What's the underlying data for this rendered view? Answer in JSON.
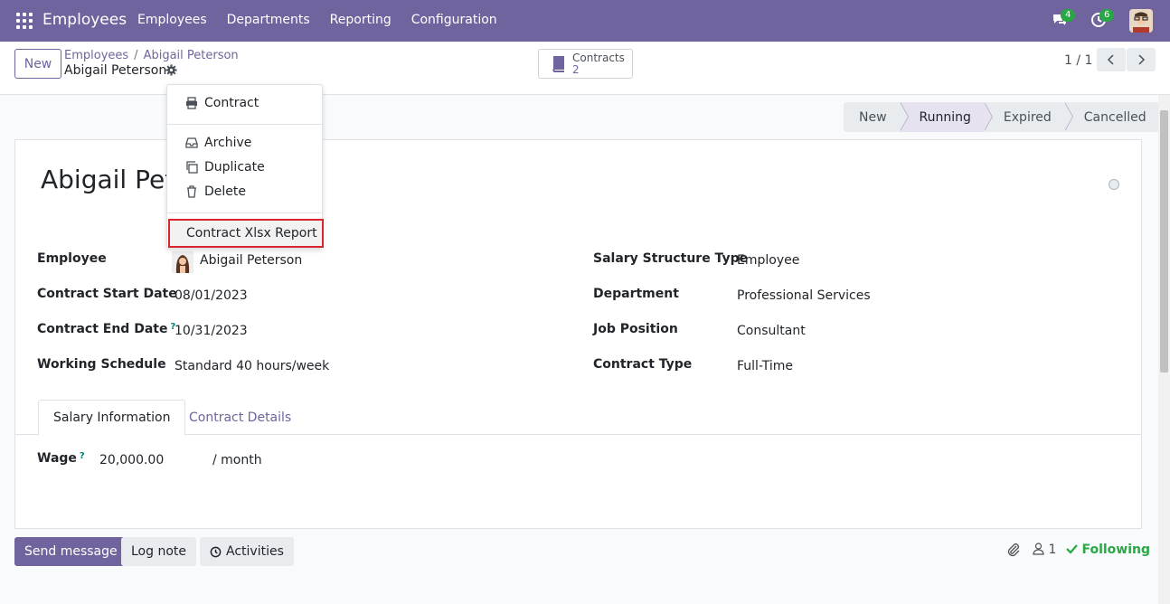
{
  "navbar": {
    "app_title": "Employees",
    "menu": [
      "Employees",
      "Departments",
      "Reporting",
      "Configuration"
    ],
    "messages_count": "4",
    "activities_count": "6",
    "brand_color": "#71639e"
  },
  "control": {
    "new_label": "New",
    "breadcrumb": [
      "Employees",
      "Abigail Peterson"
    ],
    "record_title": "Abigail Peterson",
    "smart_button": {
      "label": "Contracts",
      "count": "2"
    },
    "pager": "1 / 1"
  },
  "statusbar": [
    "New",
    "Running",
    "Expired",
    "Cancelled"
  ],
  "statusbar_active": "Running",
  "dropdown": {
    "print_items": [
      "Contract"
    ],
    "action_items": [
      "Archive",
      "Duplicate",
      "Delete"
    ],
    "report_items": [
      "Contract Xlsx Report"
    ]
  },
  "form": {
    "name": "Abigail Peterson",
    "left": [
      {
        "label": "Employee",
        "value": "Abigail Peterson",
        "help": ""
      },
      {
        "label": "Contract Start Date",
        "value": "08/01/2023",
        "help": ""
      },
      {
        "label": "Contract End Date",
        "value": "10/31/2023",
        "help": "?"
      },
      {
        "label": "Working Schedule",
        "value": "Standard 40 hours/week",
        "help": ""
      }
    ],
    "right": [
      {
        "label": "Salary Structure Type",
        "value": "Employee"
      },
      {
        "label": "Department",
        "value": "Professional Services"
      },
      {
        "label": "Job Position",
        "value": "Consultant"
      },
      {
        "label": "Contract Type",
        "value": "Full-Time"
      }
    ],
    "tabs": [
      "Salary Information",
      "Contract Details"
    ],
    "wage": {
      "label": "Wage",
      "help": "?",
      "value": "20,000.00",
      "unit": "/ month"
    }
  },
  "chatter": {
    "send_message": "Send message",
    "log_note": "Log note",
    "activities": "Activities",
    "followers_count": "1",
    "following": "Following"
  }
}
